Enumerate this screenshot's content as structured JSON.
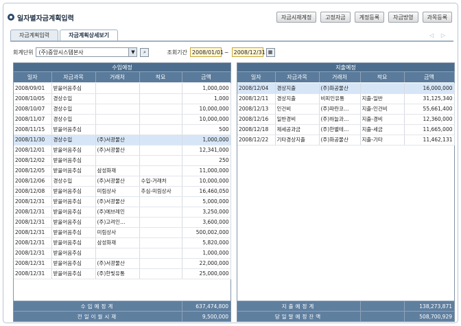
{
  "title": "일자별자금계획입력",
  "top_buttons": [
    "자금시재계정",
    "고정자금",
    "계정등록",
    "자금방영",
    "과목등록"
  ],
  "tabs": [
    "자금계획입력",
    "자금계획상세보기"
  ],
  "nav_arrows": "◁ ▷",
  "filter": {
    "unit_label": "회계단위",
    "unit_value": "(주)중앙시스템본사",
    "period_label": "조회기간",
    "date_from": "2008/01/01",
    "date_to": "2008/12/31",
    "separator": "~"
  },
  "income": {
    "title": "수입예정",
    "columns": [
      "일자",
      "자금과목",
      "거래처",
      "적요",
      "금액"
    ],
    "rows": [
      [
        "2008/09/01",
        "받을어음추심",
        "",
        "",
        "1,000,000"
      ],
      [
        "2008/10/05",
        "경상수입",
        "",
        "",
        "1,000"
      ],
      [
        "2008/10/07",
        "경상수입",
        "",
        "",
        "10,000,000"
      ],
      [
        "2008/11/07",
        "경상수입",
        "",
        "",
        "10,000,000"
      ],
      [
        "2008/11/15",
        "받을어음추심",
        "",
        "",
        "500"
      ],
      [
        "2008/11/30",
        "경상수입",
        "(주)서광물산",
        "",
        "1,000,000"
      ],
      [
        "2008/12/01",
        "받을어음추심",
        "(주)서광물산",
        "",
        "12,341,000"
      ],
      [
        "2008/12/02",
        "받을어음추심",
        "",
        "",
        "250"
      ],
      [
        "2008/12/05",
        "받을어음추심",
        "삼성화재",
        "",
        "11,000,000"
      ],
      [
        "2008/12/06",
        "경상수입",
        "(주)서광물산",
        "수입-거래처",
        "10,000,000"
      ],
      [
        "2008/12/08",
        "받을어음추심",
        "미림상사",
        "추심-미림상사",
        "16,460,050"
      ],
      [
        "2008/12/31",
        "받을어음추심",
        "(주)서광물산",
        "",
        "5,000,000"
      ],
      [
        "2008/12/31",
        "받을어음추심",
        "(주)에브레인",
        "",
        "3,250,000"
      ],
      [
        "2008/12/31",
        "받을어음추심",
        "(주)고려인…",
        "",
        "3,600,000"
      ],
      [
        "2008/12/31",
        "받을어음추심",
        "미림상사",
        "",
        "500,002,000"
      ],
      [
        "2008/12/31",
        "받을어음추심",
        "삼성화재",
        "",
        "5,820,000"
      ],
      [
        "2008/12/31",
        "받을어음추심",
        "",
        "",
        "1,000,000"
      ],
      [
        "2008/12/31",
        "받을어음추심",
        "(주)서광물산",
        "",
        "22,000,000"
      ],
      [
        "2008/12/31",
        "받을어음추심",
        "(주)한빛유통",
        "",
        "25,000,000"
      ]
    ],
    "selected_row": 5,
    "total_label": "수입예정계",
    "total_value": "637,474,800",
    "carry_label": "전일이월시재",
    "carry_value": "9,500,000"
  },
  "expense": {
    "title": "지출예정",
    "columns": [
      "일자",
      "자금과목",
      "거래처",
      "적요",
      "금액"
    ],
    "rows": [
      [
        "2008/12/04",
        "경상지출",
        "(주)화공물산",
        "",
        "16,000,000"
      ],
      [
        "2008/12/11",
        "경상지출",
        "비피인유통",
        "지출-일반",
        "31,125,340"
      ],
      [
        "2008/12/13",
        "인건비",
        "(주)파란코…",
        "지출-인건비",
        "55,661,400"
      ],
      [
        "2008/12/16",
        "일반경비",
        "(주)하늘과…",
        "지출-경비",
        "12,360,000"
      ],
      [
        "2008/12/18",
        "제세공과금",
        "(주)한별테…",
        "지출-세금",
        "11,665,000"
      ],
      [
        "2008/12/22",
        "기타경상지출",
        "(주)화공물산",
        "지출-기타",
        "11,462,131"
      ]
    ],
    "selected_row": 0,
    "total_label": "지출예정계",
    "total_value": "138,273,871",
    "balance_label": "당일말예정잔액",
    "balance_value": "508,700,929"
  }
}
